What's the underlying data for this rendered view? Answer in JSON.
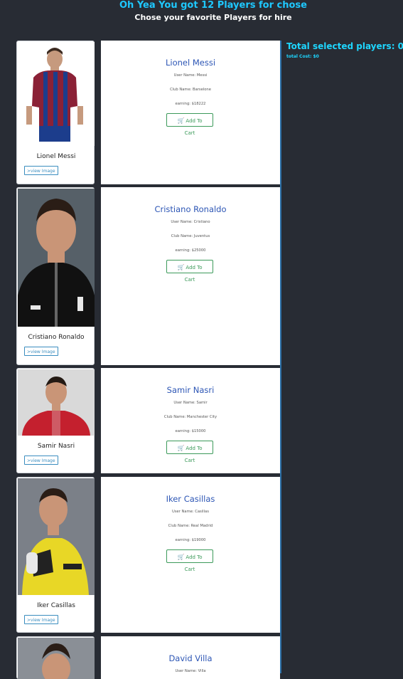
{
  "header": {
    "title": "Oh Yea You got 12 Players for chose",
    "subtitle": "Chose your favorite Players for hire"
  },
  "summary": {
    "total_label": "Total selected players: 0",
    "cost_label": "total Cost: $0"
  },
  "players": [
    {
      "name": "Lionel Messi",
      "user_name": "User Name: Messi",
      "club": "Club Name: Barselone",
      "earning": "earning: $18222",
      "view_label": ">view Image",
      "cart_label": "Add To Cart",
      "kit_color": "#8b2136"
    },
    {
      "name": "Cristiano Ronaldo",
      "user_name": "User Name: Cristiano",
      "club": "Club Name: Juventus",
      "earning": "earning: $25000",
      "view_label": ">view Image",
      "cart_label": "Add To Cart",
      "kit_color": "#1a1a1a"
    },
    {
      "name": "Samir Nasri",
      "user_name": "User Name: Samir",
      "club": "Club Name: Manchester City",
      "earning": "earning: $15000",
      "view_label": ">view Image",
      "cart_label": "Add To Cart",
      "kit_color": "#c4202e"
    },
    {
      "name": "Iker Casillas",
      "user_name": "User Name: Casillas",
      "club": "Club Name: Real Madrid",
      "earning": "earning: $19000",
      "view_label": ">view Image",
      "cart_label": "Add To Cart",
      "kit_color": "#e8d726"
    },
    {
      "name": "David Villa",
      "user_name": "User Name: Villa"
    }
  ]
}
